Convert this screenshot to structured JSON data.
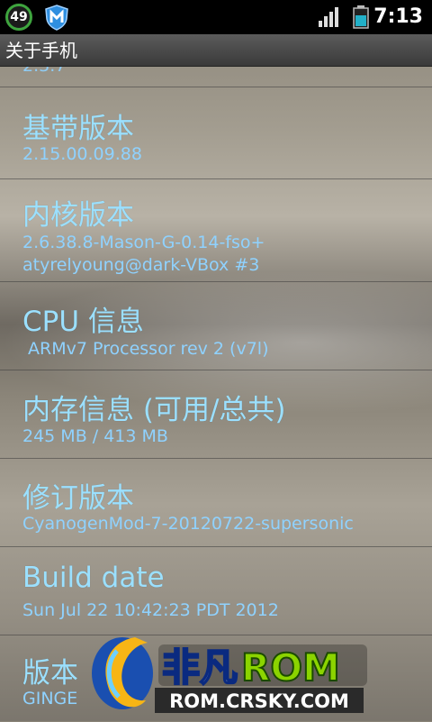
{
  "status": {
    "badge": "49",
    "time": "7:13"
  },
  "title": "关于手机",
  "items": [
    {
      "title": "基带版本",
      "summary": "2.15.00.09.88"
    },
    {
      "title": "内核版本",
      "summary_line1": "2.6.38.8-Mason-G-0.14-fso+",
      "summary_line2": "atyrelyoung@dark-VBox #3"
    },
    {
      "title": "CPU 信息",
      "summary": " ARMv7 Processor rev 2 (v7l)"
    },
    {
      "title": "内存信息 (可用/总共)",
      "summary": "245 MB / 413 MB"
    },
    {
      "title": "修订版本",
      "summary": "CyanogenMod-7-20120722-supersonic"
    },
    {
      "title": "Build date",
      "summary": "Sun Jul 22 10:42:23 PDT 2012"
    },
    {
      "title": "版本",
      "summary": "GINGE"
    }
  ],
  "watermark": {
    "brand": "非凡ROM",
    "url": "ROM.CRSKY.COM"
  },
  "colors": {
    "accent_text": "#9be0ff",
    "statusbar": "#000000"
  }
}
